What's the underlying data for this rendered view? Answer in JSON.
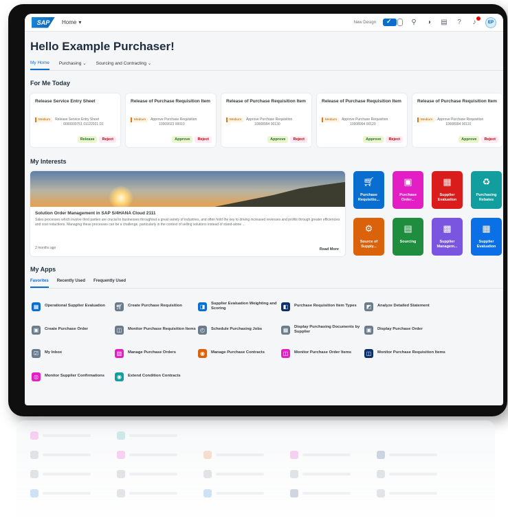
{
  "shell": {
    "logo": "SAP",
    "home_menu": "Home",
    "new_design": "New Design",
    "avatar_initials": "EP"
  },
  "greeting": "Hello Example Purchaser!",
  "tabs": [
    "My Home",
    "Purchasing",
    "Sourcing and Contracting"
  ],
  "for_me_today": {
    "title": "For Me Today",
    "cards": [
      {
        "title": "Release Service Entry Sheet",
        "priority": "Medium",
        "desc1": "Release Service Entry Sheet",
        "desc2": "0000000751 01122021 D1",
        "primary": "Release",
        "secondary": "Reject"
      },
      {
        "title": "Release of Purchase Requisition Item",
        "priority": "Medium",
        "desc1": "Approve Purchase Requisition",
        "desc2": "10009023 00010",
        "primary": "Approve",
        "secondary": "Reject"
      },
      {
        "title": "Release of Purchase Requisition Item",
        "priority": "Medium",
        "desc1": "Approve Purchase Requisition",
        "desc2": "10008994 00130",
        "primary": "Approve",
        "secondary": "Reject"
      },
      {
        "title": "Release of Purchase Requisition Item",
        "priority": "Medium",
        "desc1": "Approve Purchase Requisition",
        "desc2": "10008994 00120",
        "primary": "Approve",
        "secondary": "Reject"
      },
      {
        "title": "Release of Purchase Requisition Item",
        "priority": "Medium",
        "desc1": "Approve Purchase Requisition",
        "desc2": "10008994 00110",
        "primary": "Approve",
        "secondary": "Reject"
      }
    ]
  },
  "my_interests": {
    "title": "My Interests",
    "news": {
      "title": "Solution Order Management in SAP S/4HANA Cloud 2111",
      "body": "Sales processes which involve third parties are crucial to businesses throughout a great variety of industries, and often hold the key to driving increased revenues and profits through greater efficiencies and cost reductions. Managing these processes can be a challenge, particularly in the context of selling solutions instead of stand-alone ...",
      "date": "2 months ago",
      "more": "Read More"
    },
    "tiles": [
      {
        "label": "Purchase Requisitio...",
        "color": "#0a6ed1",
        "icon": "cart-icon"
      },
      {
        "label": "Purchase Order...",
        "color": "#e31ec4",
        "icon": "document-icon"
      },
      {
        "label": "Supplier Evaluation",
        "color": "#d91c1c",
        "icon": "evaluation-icon"
      },
      {
        "label": "Purchasing Rebates",
        "color": "#129e9e",
        "icon": "rebates-icon"
      },
      {
        "label": "Source of Supply...",
        "color": "#d9620a",
        "icon": "supply-icon"
      },
      {
        "label": "Sourcing",
        "color": "#1e8e3e",
        "icon": "sourcing-icon"
      },
      {
        "label": "Supplier Managem...",
        "color": "#7a55e0",
        "icon": "supplier-icon"
      },
      {
        "label": "Supplier Evaluation",
        "color": "#0b6fe6",
        "icon": "evaluation-icon"
      }
    ]
  },
  "my_apps": {
    "title": "My Apps",
    "tabs": [
      "Favorites",
      "Recently Used",
      "Frequently Used"
    ],
    "apps": [
      {
        "label": "Operational Supplier Evaluation",
        "color": "#0a6ed1",
        "icon": "evaluation-icon"
      },
      {
        "label": "Create Purchase Requisition",
        "color": "#6a7b8c",
        "icon": "cart-icon"
      },
      {
        "label": "Supplier Evaluation Weighting and Scoring",
        "color": "#0a6ed1",
        "icon": "scoring-icon"
      },
      {
        "label": "Purchase Requisition Item Types",
        "color": "#0a2f6e",
        "icon": "item-types-icon"
      },
      {
        "label": "Analyze Detailed Statement",
        "color": "#6a7b8c",
        "icon": "statement-icon"
      },
      {
        "label": "Create Purchase Order",
        "color": "#6a7b8c",
        "icon": "document-icon"
      },
      {
        "label": "Monitor Purchase Requisition Items",
        "color": "#6a7b8c",
        "icon": "monitor-icon"
      },
      {
        "label": "Schedule Purchasing Jobs",
        "color": "#6a7b8c",
        "icon": "schedule-icon"
      },
      {
        "label": "Display Purchasing Documents by Supplier",
        "color": "#6a7b8c",
        "icon": "table-icon"
      },
      {
        "label": "Display Purchase Order",
        "color": "#6a7b8c",
        "icon": "document-icon"
      },
      {
        "label": "My Inbox",
        "color": "#6a7b8c",
        "icon": "inbox-icon"
      },
      {
        "label": "Manage Purchase Orders",
        "color": "#e31ec4",
        "icon": "orders-icon"
      },
      {
        "label": "Manage Purchase Contracts",
        "color": "#d9620a",
        "icon": "contracts-icon"
      },
      {
        "label": "Monitor Purchase Order Items",
        "color": "#e31ec4",
        "icon": "monitor-icon"
      },
      {
        "label": "Monitor Purchase Requisition Items",
        "color": "#0a2f6e",
        "icon": "monitor-icon"
      },
      {
        "label": "Monitor Supplier Confirmations",
        "color": "#e31ec4",
        "icon": "confirmations-icon"
      },
      {
        "label": "Extend Condition Contracts",
        "color": "#129e9e",
        "icon": "contracts-icon"
      }
    ]
  }
}
